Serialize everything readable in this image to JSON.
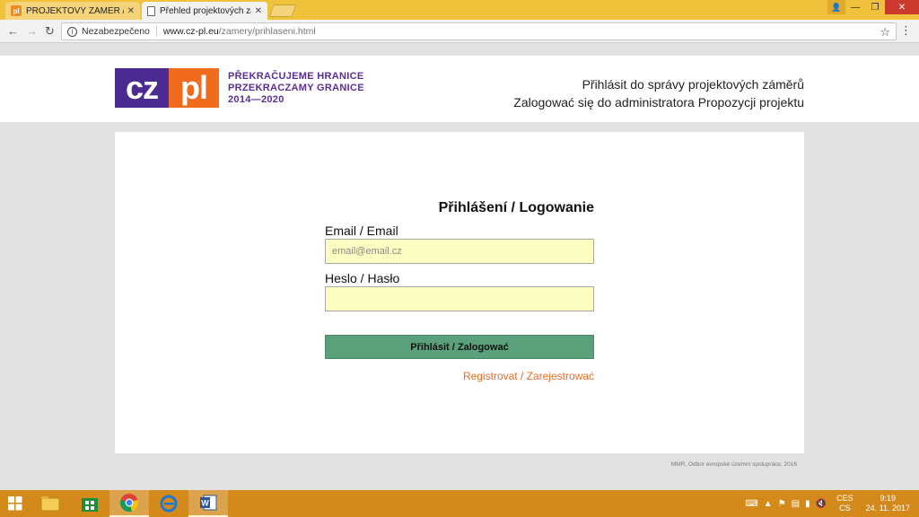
{
  "browser": {
    "tabs": [
      {
        "title": "PROJEKTOVÝ ZÁMĚR / P",
        "favicon": "pl"
      },
      {
        "title": "Přehled projektových zán",
        "favicon": "doc"
      }
    ],
    "security_label": "Nezabezpečeno",
    "url_host": "www.cz-pl.eu",
    "url_path": "/zamery/prihlaseni.html"
  },
  "header": {
    "logo_cz": "cz",
    "logo_pl": "pl",
    "logo_line1": "PŘEKRAČUJEME HRANICE",
    "logo_line2": "PRZEKRACZAMY GRANICE",
    "logo_line3": "2014—2020",
    "title_cs": "Přihlásit do správy projektových záměrů",
    "title_pl": "Zalogować się do administratora Propozycji projektu"
  },
  "login": {
    "heading": "Přihlášení / Logowanie",
    "email_label": "Email / Email",
    "email_placeholder": "email@email.cz",
    "password_label": "Heslo / Hasło",
    "submit_label": "Přihlásit / Zalogować",
    "register_link": "Registrovat / Zarejestrować"
  },
  "footer": {
    "note": "MMR, Odbor evropské územní spolupráce, 2016"
  },
  "taskbar": {
    "lang_top": "CES",
    "lang_bottom": "CS",
    "time": "9:19",
    "date": "24. 11. 2017"
  }
}
